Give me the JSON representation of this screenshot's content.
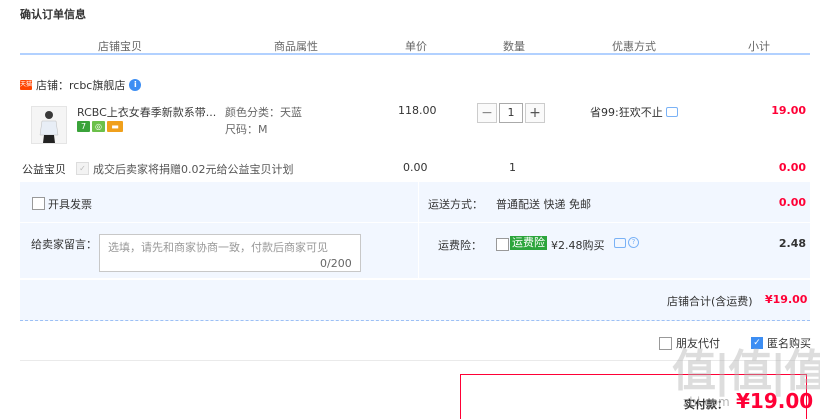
{
  "page_title": "确认订单信息",
  "columns": [
    "店铺宝贝",
    "商品属性",
    "单价",
    "数量",
    "优惠方式",
    "小计"
  ],
  "shop": {
    "tag": "天猫",
    "label": "店铺：rcbc旗舰店",
    "info_icon": "i"
  },
  "item": {
    "title": "RCBC上衣女春季新款系带...",
    "badges": [
      {
        "label": "7",
        "color": "#3aa33a"
      },
      {
        "label": "◎",
        "color": "#6cc04a"
      },
      {
        "label": "▬",
        "color": "#f0a01c"
      }
    ],
    "attr_color": "颜色分类：天蓝",
    "attr_size": "尺码：M",
    "price": "118.00",
    "qty_minus": "−",
    "qty_value": "1",
    "qty_plus": "+",
    "promo": "省99:狂欢不止",
    "subtotal": "19.00"
  },
  "charity": {
    "label": "公益宝贝",
    "check": "✓",
    "text": "成交后卖家将捐赠0.02元给公益宝贝计划",
    "price": "0.00",
    "qty": "1",
    "subtotal": "0.00"
  },
  "invoice": {
    "label": "开具发票"
  },
  "shipping": {
    "label": "运送方式：",
    "value": "普通配送 快递 免邮",
    "cost": "0.00"
  },
  "memo": {
    "label": "给卖家留言：",
    "placeholder": "选填，请先和商家协商一致，付款后商家可见",
    "count": "0/200"
  },
  "insurance": {
    "label": "运费险：",
    "tag": "运费险",
    "value": "¥2.48购买",
    "help": "?",
    "cost": "2.48"
  },
  "summary": {
    "label": "店铺合计(含运费)",
    "value": "¥19.00"
  },
  "options": {
    "friend_pay": "朋友代付",
    "anonymous": "匿名购买",
    "check": "✓"
  },
  "pay": {
    "label": "实付款：",
    "value": "¥19.00"
  },
  "watermark": "值|值|值",
  "watermark_sub": "zhi.com"
}
